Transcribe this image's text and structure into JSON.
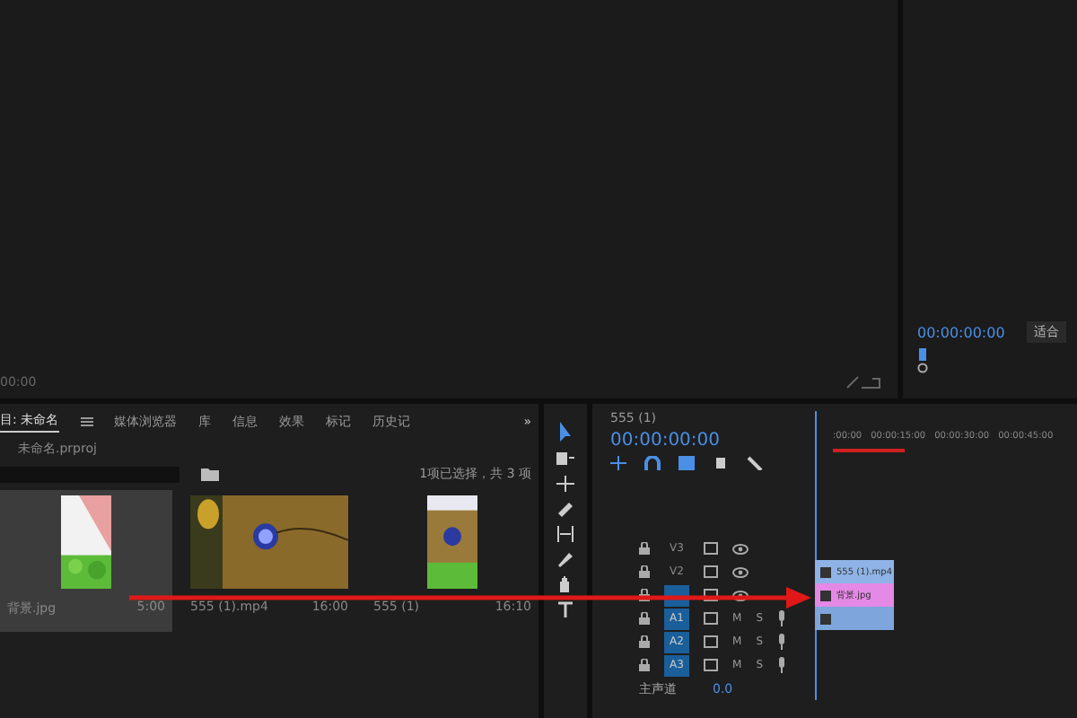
{
  "source_monitor": {
    "timecode": "00:00"
  },
  "program_monitor": {
    "timecode": "00:00:00:00",
    "zoom": "适合"
  },
  "project_panel": {
    "tabs": [
      {
        "label": "目: 未命名",
        "selected": true
      },
      {
        "label": "媒体浏览器",
        "selected": false
      },
      {
        "label": "库",
        "selected": false
      },
      {
        "label": "信息",
        "selected": false
      },
      {
        "label": "效果",
        "selected": false
      },
      {
        "label": "标记",
        "selected": false
      },
      {
        "label": "历史记",
        "selected": false
      }
    ],
    "more": "»",
    "path": "未命名.prproj",
    "selection_count": "1项已选择，共 3 项",
    "items": [
      {
        "name": "背景.jpg",
        "duration": "5:00",
        "selected": true
      },
      {
        "name": "555 (1).mp4",
        "duration": "16:00",
        "selected": false,
        "kind": "video"
      },
      {
        "name": "555 (1)",
        "duration": "16:10",
        "selected": false,
        "kind": "sequence"
      }
    ]
  },
  "timeline": {
    "sequence": "555 (1)",
    "timecode": "00:00:00:00",
    "ruler": [
      ":00:00",
      "00:00:15:00",
      "00:00:30:00",
      "00:00:45:00"
    ],
    "tracks": [
      {
        "label": "V3",
        "kind": "video",
        "targeted": false
      },
      {
        "label": "V2",
        "kind": "video",
        "targeted": false
      },
      {
        "kind": "video",
        "targeted": true
      },
      {
        "label": "A1",
        "kind": "audio",
        "targeted": true,
        "mute": "M",
        "solo": "S"
      },
      {
        "label": "A2",
        "kind": "audio",
        "targeted": true,
        "mute": "M",
        "solo": "S"
      },
      {
        "label": "A3",
        "kind": "audio",
        "targeted": true,
        "mute": "M",
        "solo": "S"
      }
    ],
    "master": {
      "label": "主声道",
      "value": "0.0"
    },
    "clips": [
      {
        "name": "555 (1).mp4",
        "kind": "video"
      },
      {
        "name": "背景.jpg"
      },
      {
        "kind": "audio"
      }
    ]
  }
}
